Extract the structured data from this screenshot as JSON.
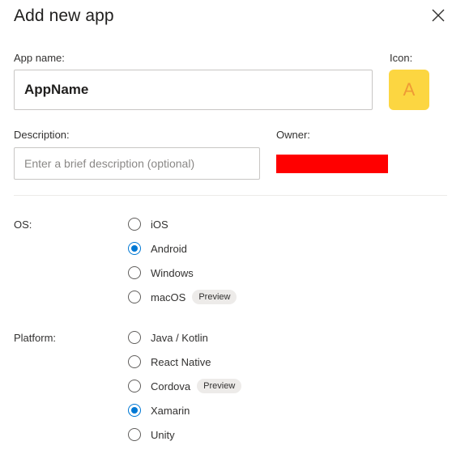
{
  "dialog": {
    "title": "Add new app",
    "close_icon": "close-icon"
  },
  "fields": {
    "app_name_label": "App name:",
    "app_name_value": "AppName",
    "icon_label": "Icon:",
    "icon_letter": "A",
    "description_label": "Description:",
    "description_placeholder": "Enter a brief description (optional)",
    "owner_label": "Owner:"
  },
  "os": {
    "label": "OS:",
    "options": [
      {
        "label": "iOS",
        "checked": false,
        "badge": ""
      },
      {
        "label": "Android",
        "checked": true,
        "badge": ""
      },
      {
        "label": "Windows",
        "checked": false,
        "badge": ""
      },
      {
        "label": "macOS",
        "checked": false,
        "badge": "Preview"
      }
    ]
  },
  "platform": {
    "label": "Platform:",
    "options": [
      {
        "label": "Java / Kotlin",
        "checked": false,
        "badge": ""
      },
      {
        "label": "React Native",
        "checked": false,
        "badge": ""
      },
      {
        "label": "Cordova",
        "checked": false,
        "badge": "Preview"
      },
      {
        "label": "Xamarin",
        "checked": true,
        "badge": ""
      },
      {
        "label": "Unity",
        "checked": false,
        "badge": ""
      }
    ]
  },
  "colors": {
    "accent": "#0078d4",
    "icon_background": "#fcd641",
    "icon_letter": "#ef9a35",
    "owner_redaction": "#ff0000"
  }
}
